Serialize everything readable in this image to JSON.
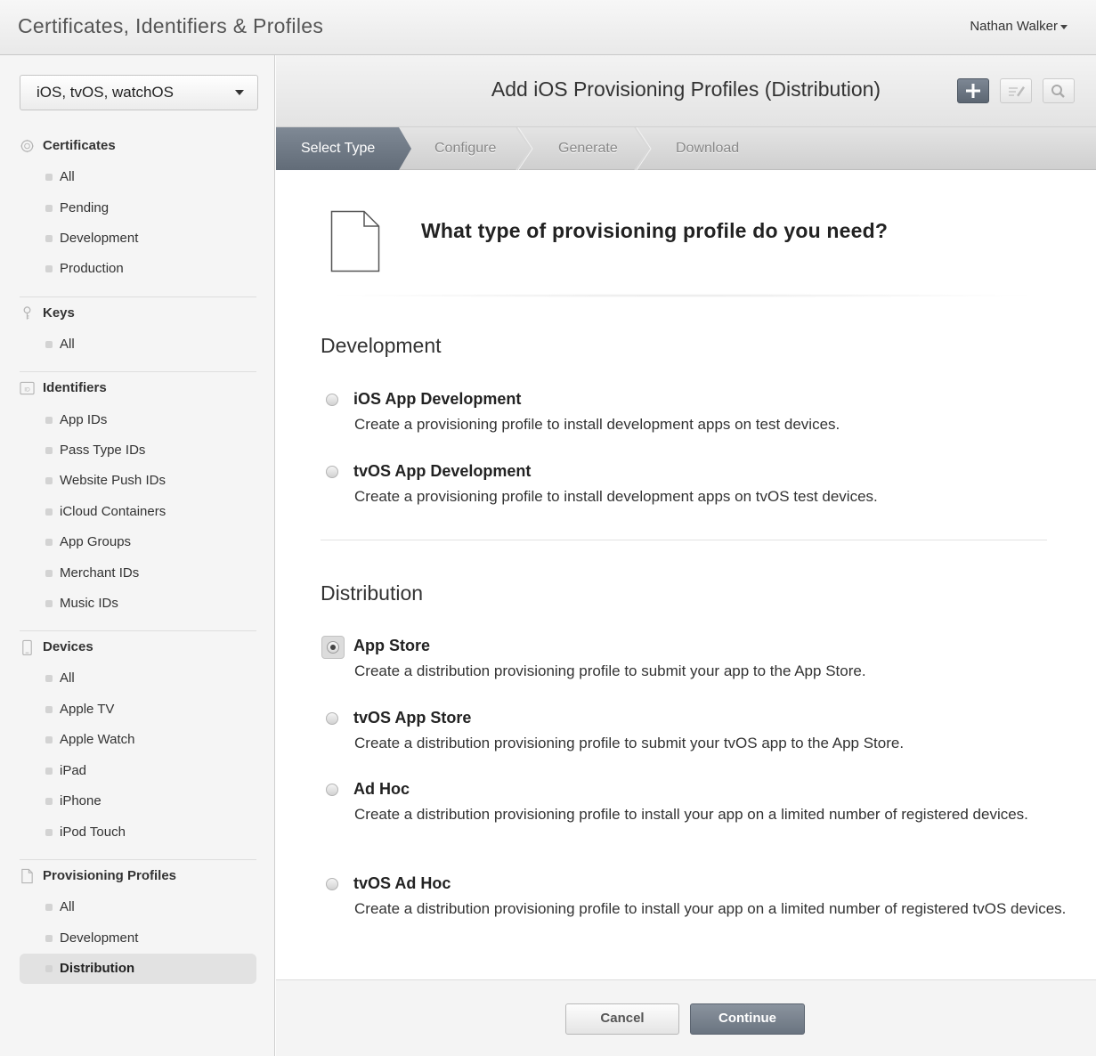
{
  "header": {
    "app_title": "Certificates, Identifiers & Profiles",
    "user_name": "Nathan Walker"
  },
  "sidebar": {
    "platform": "iOS, tvOS, watchOS",
    "sections": [
      {
        "title": "Certificates",
        "icon": "certificate-icon",
        "items": [
          "All",
          "Pending",
          "Development",
          "Production"
        ]
      },
      {
        "title": "Keys",
        "icon": "key-icon",
        "items": [
          "All"
        ]
      },
      {
        "title": "Identifiers",
        "icon": "id-icon",
        "items": [
          "App IDs",
          "Pass Type IDs",
          "Website Push IDs",
          "iCloud Containers",
          "App Groups",
          "Merchant IDs",
          "Music IDs"
        ]
      },
      {
        "title": "Devices",
        "icon": "device-icon",
        "items": [
          "All",
          "Apple TV",
          "Apple Watch",
          "iPad",
          "iPhone",
          "iPod Touch"
        ]
      },
      {
        "title": "Provisioning Profiles",
        "icon": "document-icon",
        "items": [
          "All",
          "Development",
          "Distribution"
        ]
      }
    ],
    "selected": "Provisioning Profiles / Distribution"
  },
  "main": {
    "heading": "Add iOS Provisioning Profiles (Distribution)",
    "steps": [
      "Select Type",
      "Configure",
      "Generate",
      "Download"
    ],
    "active_step": "Select Type",
    "question": "What type of provisioning profile do you need?",
    "groups": [
      {
        "title": "Development",
        "options": [
          {
            "title": "iOS App Development",
            "desc": "Create a provisioning profile to install development apps on test devices.",
            "checked": false
          },
          {
            "title": "tvOS App Development",
            "desc": "Create a provisioning profile to install development apps on tvOS test devices.",
            "checked": false
          }
        ]
      },
      {
        "title": "Distribution",
        "options": [
          {
            "title": "App Store",
            "desc": "Create a distribution provisioning profile to submit your app to the App Store.",
            "checked": true
          },
          {
            "title": "tvOS App Store",
            "desc": "Create a distribution provisioning profile to submit your tvOS app to the App Store.",
            "checked": false
          },
          {
            "title": "Ad Hoc",
            "desc": "Create a distribution provisioning profile to install your app on a limited number of registered devices.",
            "checked": false
          },
          {
            "title": "tvOS Ad Hoc",
            "desc": "Create a distribution provisioning profile to install your app on a limited number of registered tvOS devices.",
            "checked": false
          }
        ]
      }
    ],
    "buttons": {
      "cancel": "Cancel",
      "continue": "Continue"
    }
  }
}
